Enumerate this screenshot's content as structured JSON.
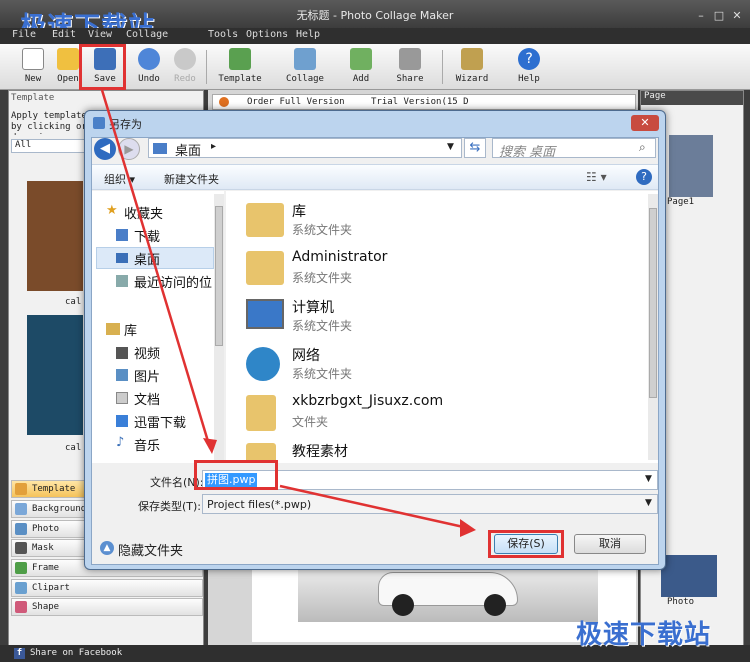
{
  "window": {
    "title": "无标题 - Photo Collage Maker"
  },
  "watermark": {
    "top_left": "极速下载站",
    "bottom_right": "极速下载站"
  },
  "menu": [
    "File",
    "Edit",
    "View",
    "Collage",
    "Tools",
    "Options",
    "Help"
  ],
  "toolbar": {
    "new": "New",
    "open": "Open",
    "save": "Save",
    "undo": "Undo",
    "redo": "Redo",
    "template": "Template",
    "collage": "Collage",
    "add": "Add",
    "share": "Share",
    "wizard": "Wizard",
    "help": "Help"
  },
  "left_panel": {
    "header": "Template",
    "hint": "Apply template by clicking or dragging",
    "filter": "All",
    "thumb_caption_1": "cal",
    "thumb_caption_2": "cal",
    "nav": [
      "Template",
      "Background",
      "Photo",
      "Mask",
      "Frame",
      "Clipart",
      "Shape"
    ]
  },
  "center": {
    "tab_order": "Order Full Version",
    "tab_trial": "Trial Version(15 D"
  },
  "right_panel": {
    "header": "Page",
    "page_label": "Page1",
    "photo_label": "Photo"
  },
  "status": {
    "share": "Share on Facebook"
  },
  "dialog": {
    "title": "另存为",
    "path": "桌面",
    "search_placeholder": "搜索 桌面",
    "organize": "组织 ▾",
    "new_folder": "新建文件夹",
    "nav_favorites": "收藏夹",
    "nav_downloads": "下载",
    "nav_desktop": "桌面",
    "nav_recent": "最近访问的位",
    "nav_library": "库",
    "nav_video": "视频",
    "nav_pictures": "图片",
    "nav_docs": "文档",
    "nav_thunder": "迅雷下载",
    "nav_music": "音乐",
    "files": [
      {
        "name": "库",
        "type": "系统文件夹"
      },
      {
        "name": "Administrator",
        "type": "系统文件夹"
      },
      {
        "name": "计算机",
        "type": "系统文件夹"
      },
      {
        "name": "网络",
        "type": "系统文件夹"
      },
      {
        "name": "xkbzrbgxt_Jisuxz.com",
        "type": "文件夹"
      },
      {
        "name": "教程素材",
        "type": ""
      }
    ],
    "filename_label": "文件名(N):",
    "filename_value": "拼图.pwp",
    "filetype_label": "保存类型(T):",
    "filetype_value": "Project files(*.pwp)",
    "hide_folders": "隐藏文件夹",
    "save": "保存(S)",
    "cancel": "取消"
  },
  "colors": {
    "accent": "#e03232",
    "selection": "#3399ff",
    "watermark": "#3a6fd0"
  }
}
